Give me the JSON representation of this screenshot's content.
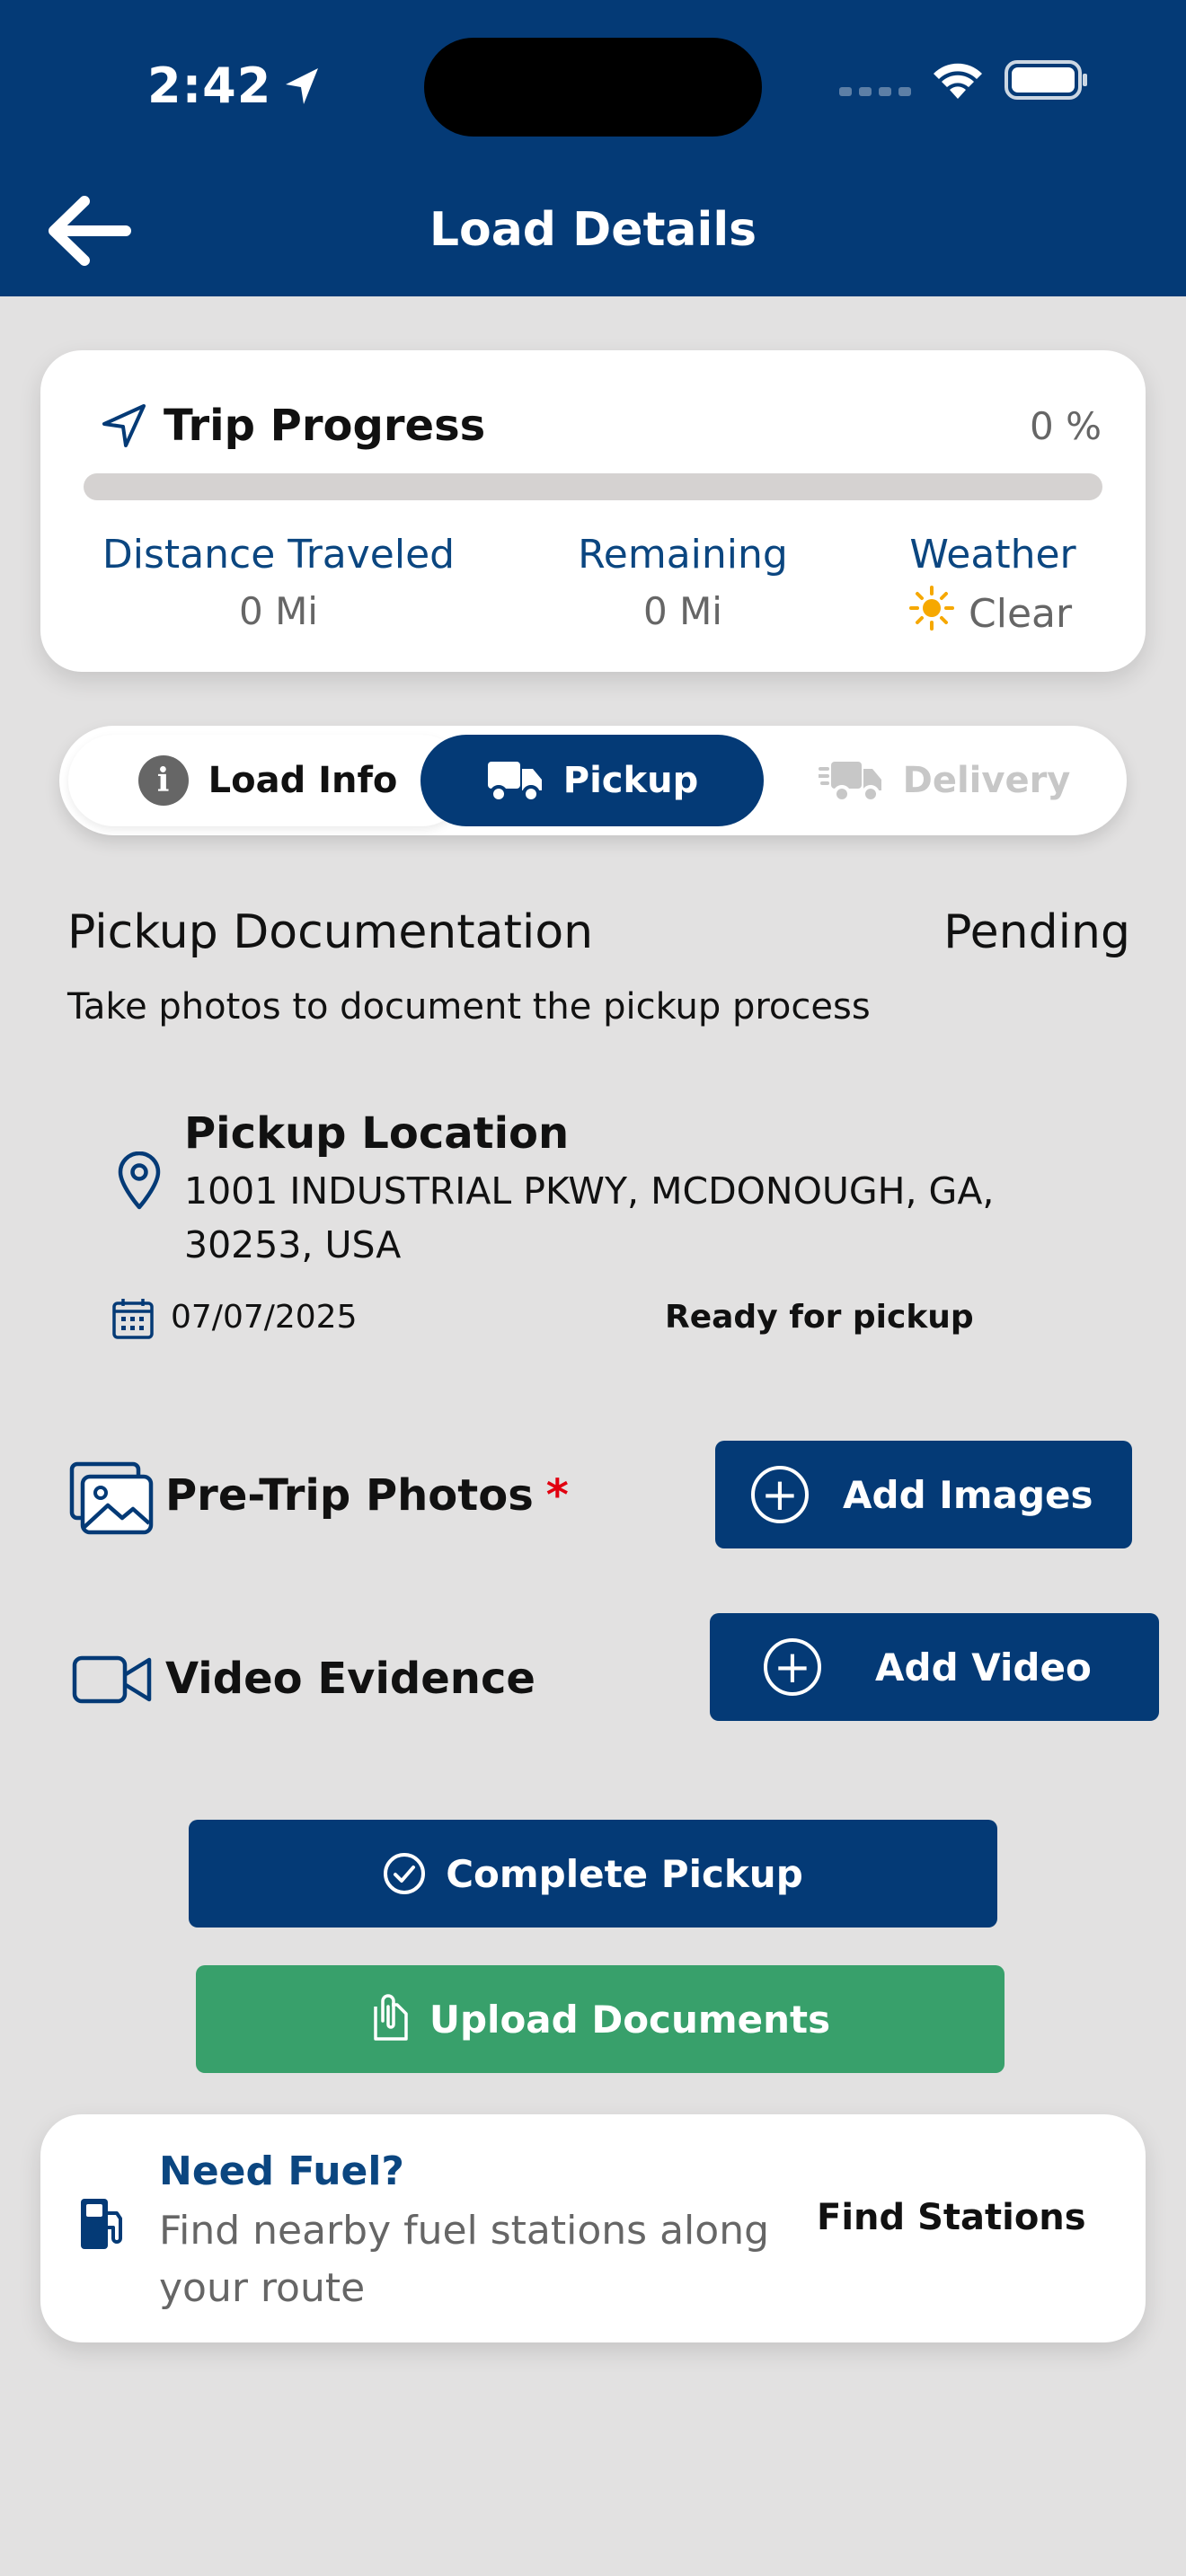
{
  "status_bar": {
    "time": "2:42"
  },
  "header": {
    "title": "Load Details"
  },
  "trip": {
    "title": "Trip Progress",
    "percent_label": "0 %",
    "progress_fraction": 0,
    "distance_label": "Distance Traveled",
    "distance_value": "0 Mi",
    "remaining_label": "Remaining",
    "remaining_value": "0 Mi",
    "weather_label": "Weather",
    "weather_value": "Clear"
  },
  "tabs": [
    {
      "label": "Load Info",
      "icon": "info-icon"
    },
    {
      "label": "Pickup",
      "icon": "truck-icon",
      "active": true
    },
    {
      "label": "Delivery",
      "icon": "truck-icon",
      "disabled": true
    }
  ],
  "pickup": {
    "title": "Pickup Documentation",
    "status": "Pending",
    "subtitle": "Take photos to document the pickup process",
    "location_title": "Pickup Location",
    "address": "1001 INDUSTRIAL PKWY, MCDONOUGH, GA, 30253, USA",
    "date": "07/07/2025",
    "ready_text": "Ready for pickup",
    "photos_label": "Pre-Trip Photos",
    "required_mark": "*",
    "add_images_label": "Add Images",
    "video_label": "Video Evidence",
    "add_video_label": "Add Video",
    "complete_label": "Complete Pickup",
    "upload_label": "Upload Documents"
  },
  "fuel": {
    "title": "Need Fuel?",
    "subtitle": "Find nearby fuel stations along your route",
    "link": "Find Stations"
  },
  "colors": {
    "navy": "#043a76",
    "green": "#38a06b",
    "background": "#e2e1e1",
    "required": "#e10010",
    "sun": "#f6a800"
  }
}
